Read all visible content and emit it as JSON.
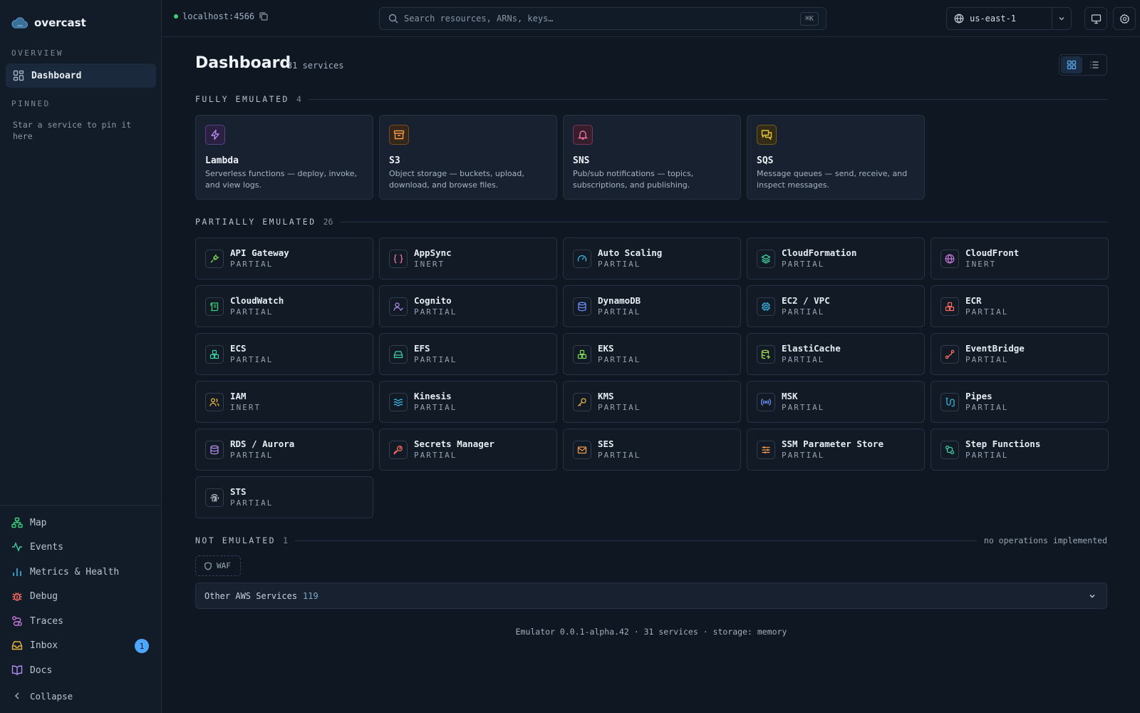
{
  "app": {
    "name": "overcast"
  },
  "sidebar": {
    "overview_label": "OVERVIEW",
    "dashboard_label": "Dashboard",
    "pinned_label": "PINNED",
    "pinned_hint": "Star a service to pin it here",
    "bottom_items": [
      {
        "label": "Map",
        "icon": "map-icon",
        "color": "#3ccf7a"
      },
      {
        "label": "Events",
        "icon": "activity-icon",
        "color": "#3ccfa0"
      },
      {
        "label": "Metrics & Health",
        "icon": "bar-chart-icon",
        "color": "#37b7e6"
      },
      {
        "label": "Debug",
        "icon": "bug-icon",
        "color": "#ff6b5e"
      },
      {
        "label": "Traces",
        "icon": "route-icon",
        "color": "#c678dd"
      },
      {
        "label": "Inbox",
        "icon": "inbox-icon",
        "color": "#e5b33e",
        "badge": "1"
      },
      {
        "label": "Docs",
        "icon": "book-icon",
        "color": "#a98be8"
      },
      {
        "label": "Collapse",
        "icon": "chevron-left-icon",
        "color": "#9fb0c2"
      }
    ]
  },
  "topbar": {
    "host": "localhost:4566",
    "search_placeholder": "Search resources, ARNs, keys…",
    "search_shortcut": "⌘K",
    "region": "us-east-1"
  },
  "page": {
    "title": "Dashboard",
    "count": "31 services"
  },
  "sections": {
    "full": {
      "name": "FULLY EMULATED",
      "count": "4"
    },
    "partial": {
      "name": "PARTIALLY EMULATED",
      "count": "26"
    },
    "none": {
      "name": "NOT EMULATED",
      "count": "1",
      "note": "no operations implemented"
    }
  },
  "full_services": [
    {
      "name": "Lambda",
      "desc": "Serverless functions — deploy, invoke, and view logs.",
      "icon": "lambda-icon",
      "color": "#b98cf5"
    },
    {
      "name": "S3",
      "desc": "Object storage — buckets, upload, download, and browse files.",
      "icon": "archive-icon",
      "color": "#f29a4a"
    },
    {
      "name": "SNS",
      "desc": "Pub/sub notifications — topics, subscriptions, and publishing.",
      "icon": "bell-icon",
      "color": "#f06ea6"
    },
    {
      "name": "SQS",
      "desc": "Message queues — send, receive, and inspect messages.",
      "icon": "messages-icon",
      "color": "#e5c13e"
    }
  ],
  "partial_services": [
    {
      "name": "API Gateway",
      "status": "PARTIAL",
      "icon": "plug-icon",
      "color": "#7ed957"
    },
    {
      "name": "AppSync",
      "status": "INERT",
      "icon": "braces-icon",
      "color": "#f06ea6"
    },
    {
      "name": "Auto Scaling",
      "status": "PARTIAL",
      "icon": "gauge-icon",
      "color": "#37b7e6"
    },
    {
      "name": "CloudFormation",
      "status": "PARTIAL",
      "icon": "layers-icon",
      "color": "#3ccfa0"
    },
    {
      "name": "CloudFront",
      "status": "INERT",
      "icon": "globe-icon",
      "color": "#c678dd"
    },
    {
      "name": "CloudWatch",
      "status": "PARTIAL",
      "icon": "scroll-icon",
      "color": "#3ccf7a"
    },
    {
      "name": "Cognito",
      "status": "PARTIAL",
      "icon": "user-check-icon",
      "color": "#a98be8"
    },
    {
      "name": "DynamoDB",
      "status": "PARTIAL",
      "icon": "database-icon",
      "color": "#6b8ff5"
    },
    {
      "name": "EC2 / VPC",
      "status": "PARTIAL",
      "icon": "cpu-icon",
      "color": "#37b7e6"
    },
    {
      "name": "ECR",
      "status": "PARTIAL",
      "icon": "boxes-icon",
      "color": "#ff6b5e"
    },
    {
      "name": "ECS",
      "status": "PARTIAL",
      "icon": "boxes-icon",
      "color": "#3ccfa0"
    },
    {
      "name": "EFS",
      "status": "PARTIAL",
      "icon": "hard-drive-icon",
      "color": "#3ccfa0"
    },
    {
      "name": "EKS",
      "status": "PARTIAL",
      "icon": "boxes-icon",
      "color": "#7ed957"
    },
    {
      "name": "ElastiCache",
      "status": "PARTIAL",
      "icon": "database-zap-icon",
      "color": "#a3d94a"
    },
    {
      "name": "EventBridge",
      "status": "PARTIAL",
      "icon": "route-icon",
      "color": "#ff6b5e"
    },
    {
      "name": "IAM",
      "status": "INERT",
      "icon": "users-icon",
      "color": "#e5b33e"
    },
    {
      "name": "Kinesis",
      "status": "PARTIAL",
      "icon": "waves-icon",
      "color": "#37b7e6"
    },
    {
      "name": "KMS",
      "status": "PARTIAL",
      "icon": "key-icon",
      "color": "#e5b33e"
    },
    {
      "name": "MSK",
      "status": "PARTIAL",
      "icon": "radio-icon",
      "color": "#6b8ff5"
    },
    {
      "name": "Pipes",
      "status": "PARTIAL",
      "icon": "pipe-icon",
      "color": "#37b7e6"
    },
    {
      "name": "RDS / Aurora",
      "status": "PARTIAL",
      "icon": "database-icon",
      "color": "#a98be8"
    },
    {
      "name": "Secrets Manager",
      "status": "PARTIAL",
      "icon": "key-round-icon",
      "color": "#ff6b5e"
    },
    {
      "name": "SES",
      "status": "PARTIAL",
      "icon": "mail-icon",
      "color": "#f29a4a"
    },
    {
      "name": "SSM Parameter Store",
      "status": "PARTIAL",
      "icon": "sliders-icon",
      "color": "#f29a4a"
    },
    {
      "name": "Step Functions",
      "status": "PARTIAL",
      "icon": "workflow-icon",
      "color": "#3ccfa0"
    },
    {
      "name": "STS",
      "status": "PARTIAL",
      "icon": "fingerprint-icon",
      "color": "#c0c8d2"
    }
  ],
  "not_emulated": [
    {
      "name": "WAF",
      "icon": "shield-icon"
    }
  ],
  "other": {
    "label": "Other AWS Services",
    "count": "119"
  },
  "footer": "Emulator 0.0.1-alpha.42 · 31 services · storage: memory"
}
